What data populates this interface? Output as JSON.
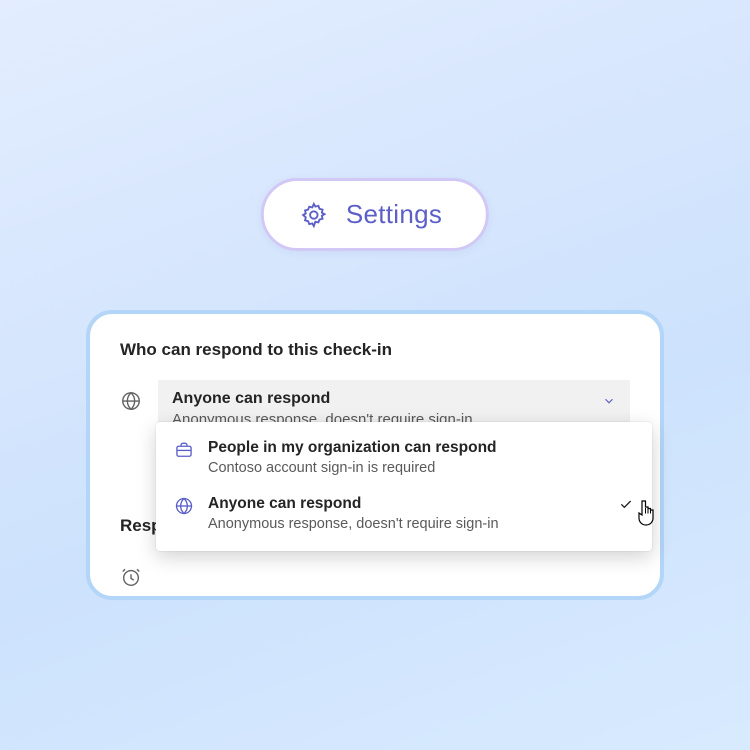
{
  "settings": {
    "label": "Settings"
  },
  "panel": {
    "respond_section_title": "Who can respond to this check-in",
    "time_section_title": "Respo",
    "selected": {
      "title": "Anyone can respond",
      "subtitle": "Anonymous response, doesn't require sign-in"
    },
    "options": [
      {
        "icon": "briefcase",
        "title": "People in my organization can respond",
        "subtitle": "Contoso account sign-in is required",
        "checked": false
      },
      {
        "icon": "globe",
        "title": "Anyone can respond",
        "subtitle": "Anonymous response, doesn't require sign-in",
        "checked": true
      }
    ]
  },
  "colors": {
    "accent": "#5b5fc7",
    "card_border": "#b3d5f7",
    "pill_border": "#d2c8f5"
  }
}
